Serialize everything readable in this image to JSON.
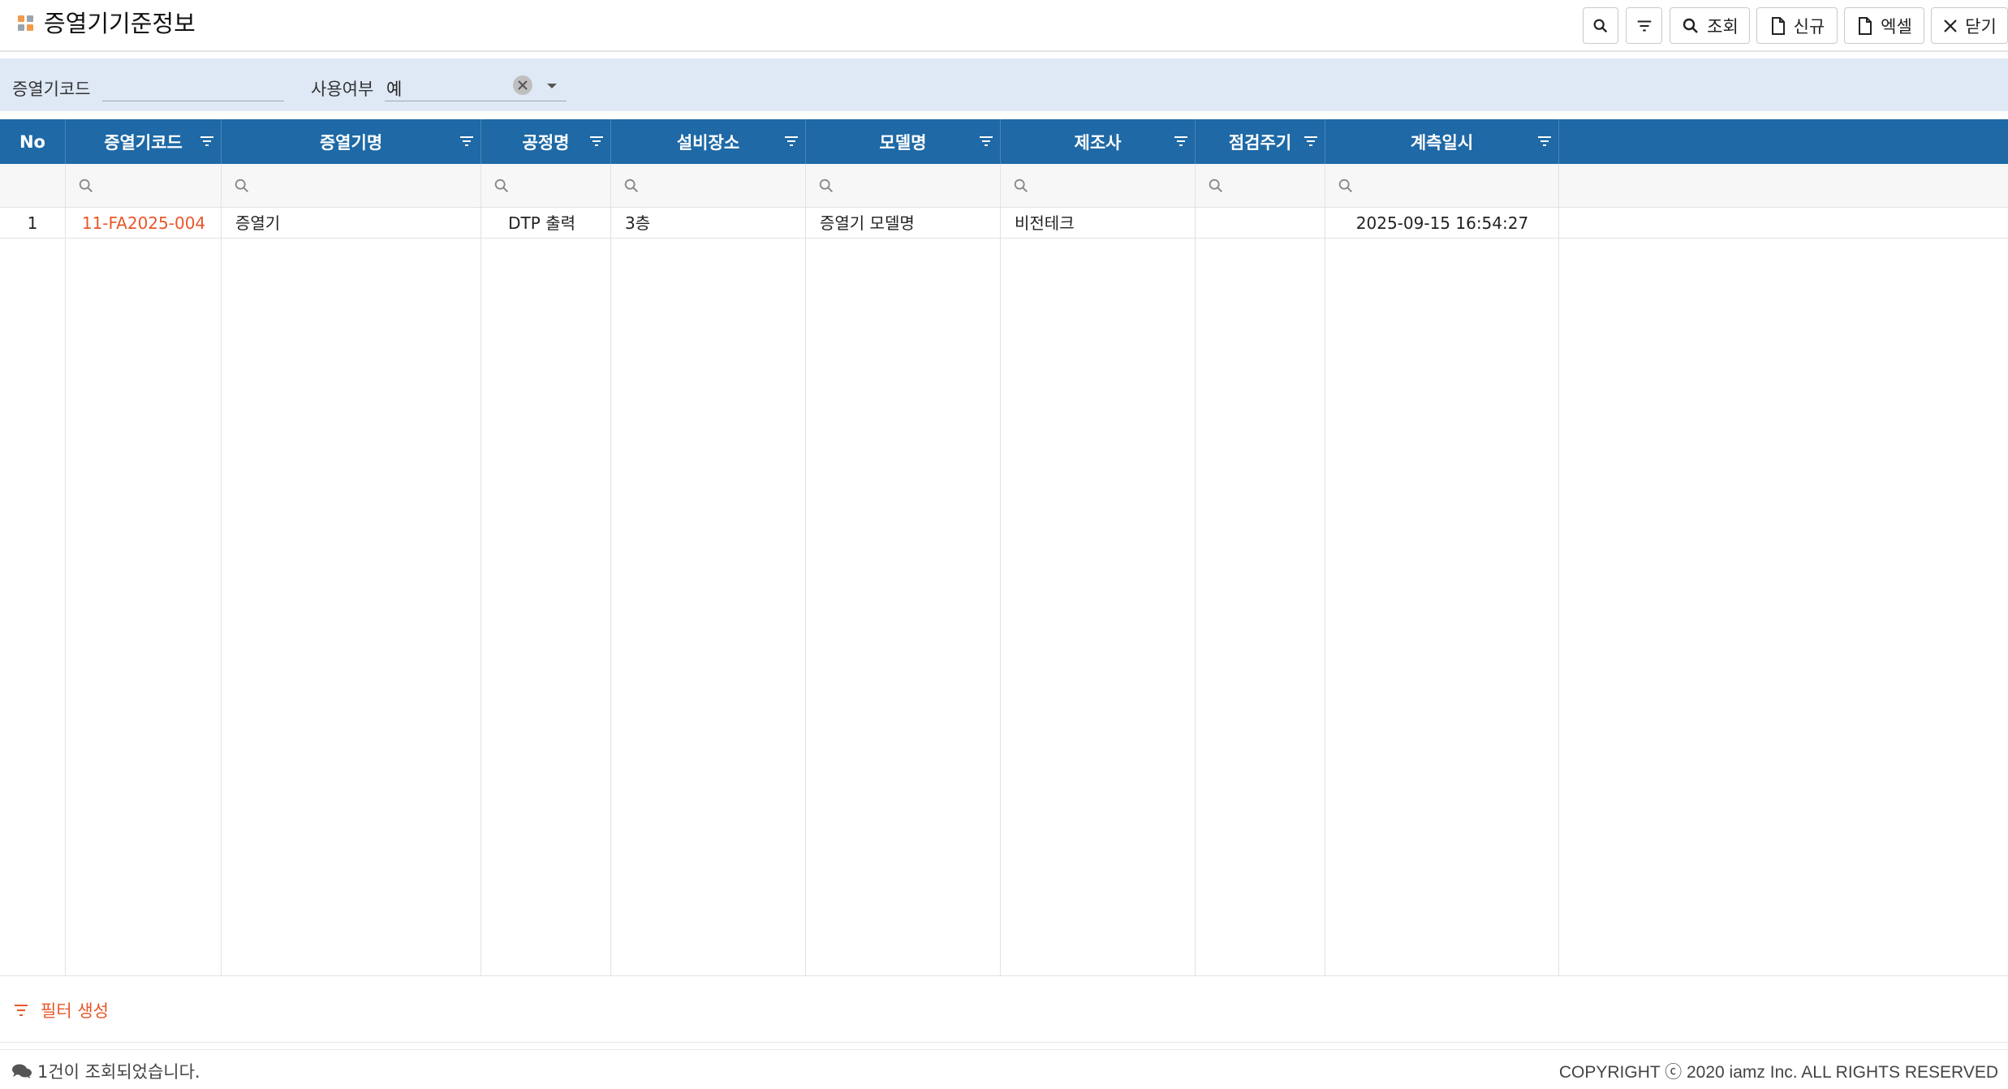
{
  "header": {
    "title": "증열기기준정보",
    "buttons": {
      "search": "조회",
      "new": "신규",
      "excel": "엑셀",
      "close": "닫기"
    }
  },
  "search": {
    "code_label": "증열기코드",
    "code_value": "",
    "use_label": "사용여부",
    "use_value": "예"
  },
  "grid": {
    "columns": [
      "No",
      "증열기코드",
      "증열기명",
      "공정명",
      "설비장소",
      "모델명",
      "제조사",
      "점검주기",
      "계측일시"
    ],
    "rows": [
      {
        "no": "1",
        "code": "11-FA2025-004",
        "name": "증열기",
        "process": "DTP 출력",
        "location": "3층",
        "model": "증열기 모델명",
        "maker": "비전테크",
        "cycle": "",
        "measured_at": "2025-09-15 16:54:27"
      }
    ]
  },
  "filter_create_label": "필터 생성",
  "status_message": "1건이 조회되었습니다.",
  "copyright": "COPYRIGHT ⓒ 2020 iamz Inc. ALL RIGHTS RESERVED",
  "colors": {
    "header_blue": "#1e69a6",
    "search_bar": "#dfe9f5",
    "accent_orange": "#e8572a"
  }
}
